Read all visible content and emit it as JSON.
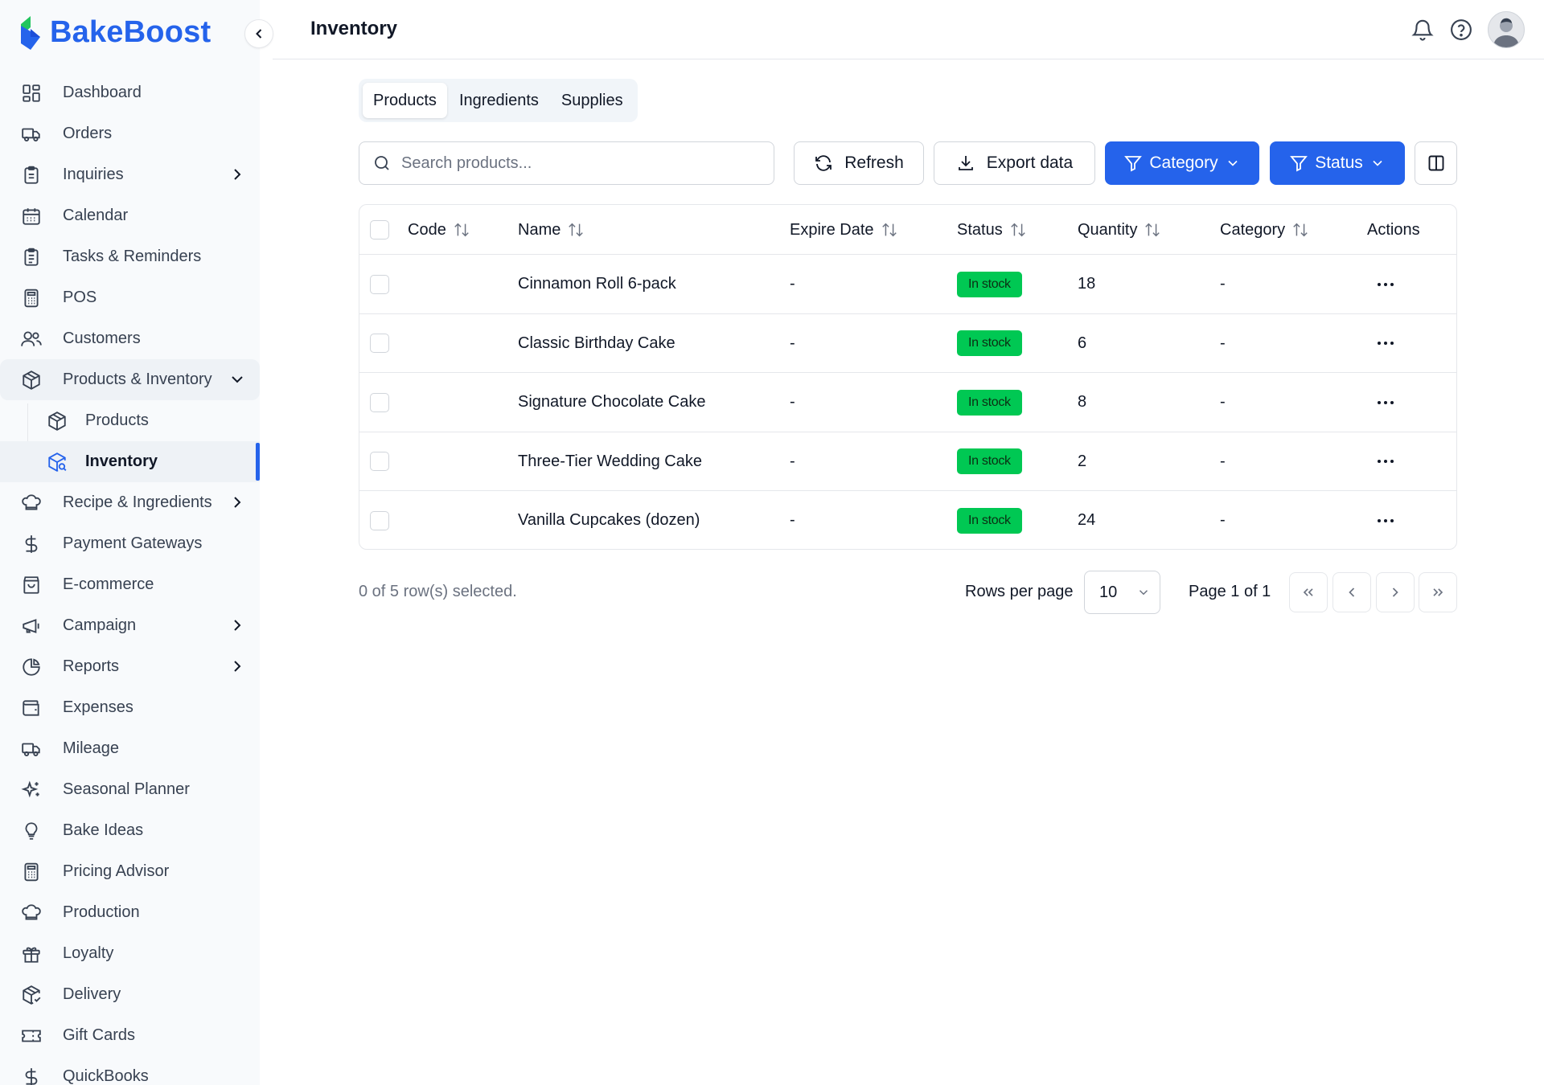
{
  "app": {
    "brand_name": "BakeBoost",
    "accent_color": "#2563eb",
    "success_color": "#00c853"
  },
  "sidebar": {
    "items": [
      {
        "label": "Dashboard",
        "icon": "dashboard-icon"
      },
      {
        "label": "Orders",
        "icon": "truck-icon"
      },
      {
        "label": "Inquiries",
        "icon": "clipboard-icon",
        "has_submenu": true
      },
      {
        "label": "Calendar",
        "icon": "calendar-icon"
      },
      {
        "label": "Tasks & Reminders",
        "icon": "clipboard-list-icon"
      },
      {
        "label": "POS",
        "icon": "calculator-icon"
      },
      {
        "label": "Customers",
        "icon": "users-icon"
      },
      {
        "label": "Products & Inventory",
        "icon": "package-icon",
        "expanded": true
      },
      {
        "label": "Recipe & Ingredients",
        "icon": "chef-hat-icon",
        "has_submenu": true
      },
      {
        "label": "Payment Gateways",
        "icon": "dollar-icon"
      },
      {
        "label": "E-commerce",
        "icon": "shopping-bag-icon"
      },
      {
        "label": "Campaign",
        "icon": "megaphone-icon",
        "has_submenu": true
      },
      {
        "label": "Reports",
        "icon": "pie-chart-icon",
        "has_submenu": true
      },
      {
        "label": "Expenses",
        "icon": "wallet-icon"
      },
      {
        "label": "Mileage",
        "icon": "truck-icon"
      },
      {
        "label": "Seasonal Planner",
        "icon": "sparkles-icon"
      },
      {
        "label": "Bake Ideas",
        "icon": "lightbulb-icon"
      },
      {
        "label": "Pricing Advisor",
        "icon": "calculator-icon"
      },
      {
        "label": "Production",
        "icon": "chef-hat-icon"
      },
      {
        "label": "Loyalty",
        "icon": "gift-icon"
      },
      {
        "label": "Delivery",
        "icon": "package-icon"
      },
      {
        "label": "Gift Cards",
        "icon": "ticket-icon"
      },
      {
        "label": "QuickBooks",
        "icon": "dollar-icon"
      }
    ],
    "submenu": [
      {
        "label": "Products",
        "icon": "package-icon"
      },
      {
        "label": "Inventory",
        "icon": "package-search-icon",
        "active": true
      }
    ]
  },
  "header": {
    "title": "Inventory"
  },
  "tabs": [
    {
      "label": "Products",
      "active": true
    },
    {
      "label": "Ingredients"
    },
    {
      "label": "Supplies"
    }
  ],
  "toolbar": {
    "search_placeholder": "Search products...",
    "refresh_label": "Refresh",
    "export_label": "Export data",
    "category_label": "Category",
    "status_label": "Status"
  },
  "table": {
    "columns": [
      "Code",
      "Name",
      "Expire Date",
      "Status",
      "Quantity",
      "Category",
      "Actions"
    ],
    "rows": [
      {
        "code": "",
        "name": "Cinnamon Roll 6-pack",
        "expire": "-",
        "status": "In stock",
        "quantity": "18",
        "category": "-"
      },
      {
        "code": "",
        "name": "Classic Birthday Cake",
        "expire": "-",
        "status": "In stock",
        "quantity": "6",
        "category": "-"
      },
      {
        "code": "",
        "name": "Signature Chocolate Cake",
        "expire": "-",
        "status": "In stock",
        "quantity": "8",
        "category": "-"
      },
      {
        "code": "",
        "name": "Three-Tier Wedding Cake",
        "expire": "-",
        "status": "In stock",
        "quantity": "2",
        "category": "-"
      },
      {
        "code": "",
        "name": "Vanilla Cupcakes (dozen)",
        "expire": "-",
        "status": "In stock",
        "quantity": "24",
        "category": "-"
      }
    ]
  },
  "footer": {
    "selected_text": "0 of 5 row(s) selected.",
    "rows_per_page_label": "Rows per page",
    "rows_per_page_value": "10",
    "page_label": "Page 1 of 1"
  }
}
